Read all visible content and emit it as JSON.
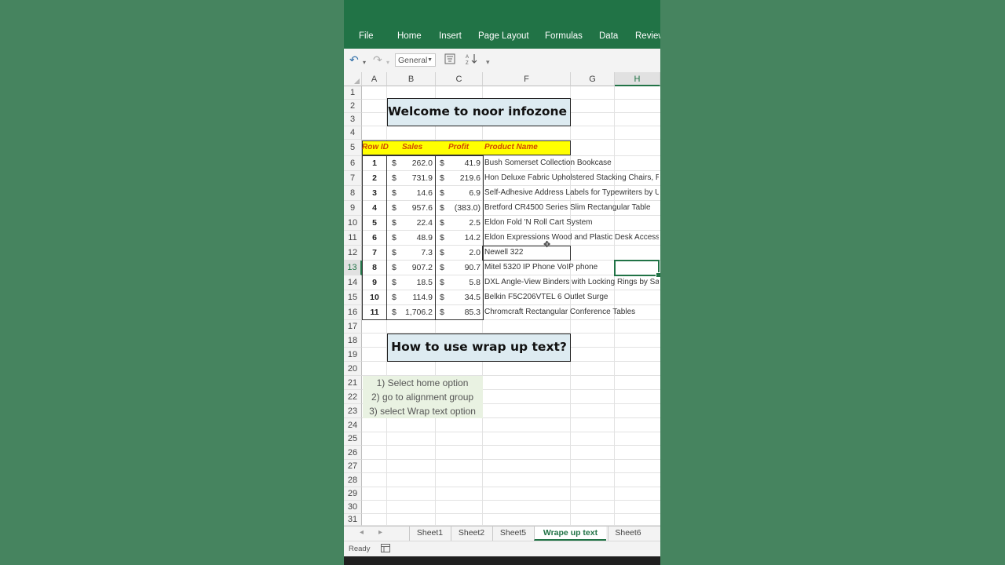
{
  "ribbon": {
    "tabs": [
      "File",
      "Home",
      "Insert",
      "Page Layout",
      "Formulas",
      "Data",
      "Review"
    ]
  },
  "qat": {
    "undo_icon": "undo-icon",
    "redo_icon": "redo-icon",
    "number_format": "General",
    "filter_icon": "filter-icon",
    "sort_icon": "sort-icon"
  },
  "columns": [
    "A",
    "B",
    "C",
    "F",
    "G",
    "H"
  ],
  "selected_column": "H",
  "rows": [
    "1",
    "2",
    "3",
    "4",
    "5",
    "6",
    "7",
    "8",
    "9",
    "10",
    "11",
    "12",
    "13",
    "14",
    "15",
    "16",
    "17",
    "18",
    "19",
    "20",
    "21",
    "22",
    "23",
    "24",
    "25",
    "26",
    "27",
    "28",
    "29",
    "30",
    "31"
  ],
  "selected_row": "13",
  "title_top": "Welcome to noor infozone Tv",
  "table": {
    "headers": [
      "Row ID",
      "Sales",
      "Profit",
      "Product Name"
    ],
    "currency": "$",
    "rows": [
      {
        "id": "1",
        "sales": "262.0",
        "profit": "41.9",
        "product": "Bush Somerset Collection Bookcase"
      },
      {
        "id": "2",
        "sales": "731.9",
        "profit": "219.6",
        "product": "Hon Deluxe Fabric Upholstered Stacking Chairs, R"
      },
      {
        "id": "3",
        "sales": "14.6",
        "profit": "6.9",
        "product": "Self-Adhesive Address Labels for Typewriters by U"
      },
      {
        "id": "4",
        "sales": "957.6",
        "profit": "(383.0)",
        "product": "Bretford CR4500 Series Slim Rectangular Table"
      },
      {
        "id": "5",
        "sales": "22.4",
        "profit": "2.5",
        "product": "Eldon Fold 'N Roll Cart System"
      },
      {
        "id": "6",
        "sales": "48.9",
        "profit": "14.2",
        "product": "Eldon Expressions Wood and Plastic Desk Accesso"
      },
      {
        "id": "7",
        "sales": "7.3",
        "profit": "2.0",
        "product": "Newell 322"
      },
      {
        "id": "8",
        "sales": "907.2",
        "profit": "90.7",
        "product": "Mitel 5320 IP Phone VoIP phone"
      },
      {
        "id": "9",
        "sales": "18.5",
        "profit": "5.8",
        "product": "DXL Angle-View Binders with Locking Rings by Sa"
      },
      {
        "id": "10",
        "sales": "114.9",
        "profit": "34.5",
        "product": "Belkin F5C206VTEL 6 Outlet Surge"
      },
      {
        "id": "11",
        "sales": "1,706.2",
        "profit": "85.3",
        "product": "Chromcraft Rectangular Conference Tables"
      }
    ]
  },
  "title_bottom": "How to use wrap up text?",
  "steps": [
    "1) Select home option",
    "2) go to alignment group",
    "3) select Wrap text option"
  ],
  "sheets": [
    "Sheet1",
    "Sheet2",
    "Sheet5",
    "Wrape up text",
    "Sheet6"
  ],
  "active_sheet": "Wrape up text",
  "status": {
    "text": "Ready",
    "icon": "page-layout-icon"
  },
  "colors": {
    "accent": "#217346",
    "header_fill": "#ffff00",
    "title_fill": "#ddebf1",
    "background": "#46845f"
  }
}
